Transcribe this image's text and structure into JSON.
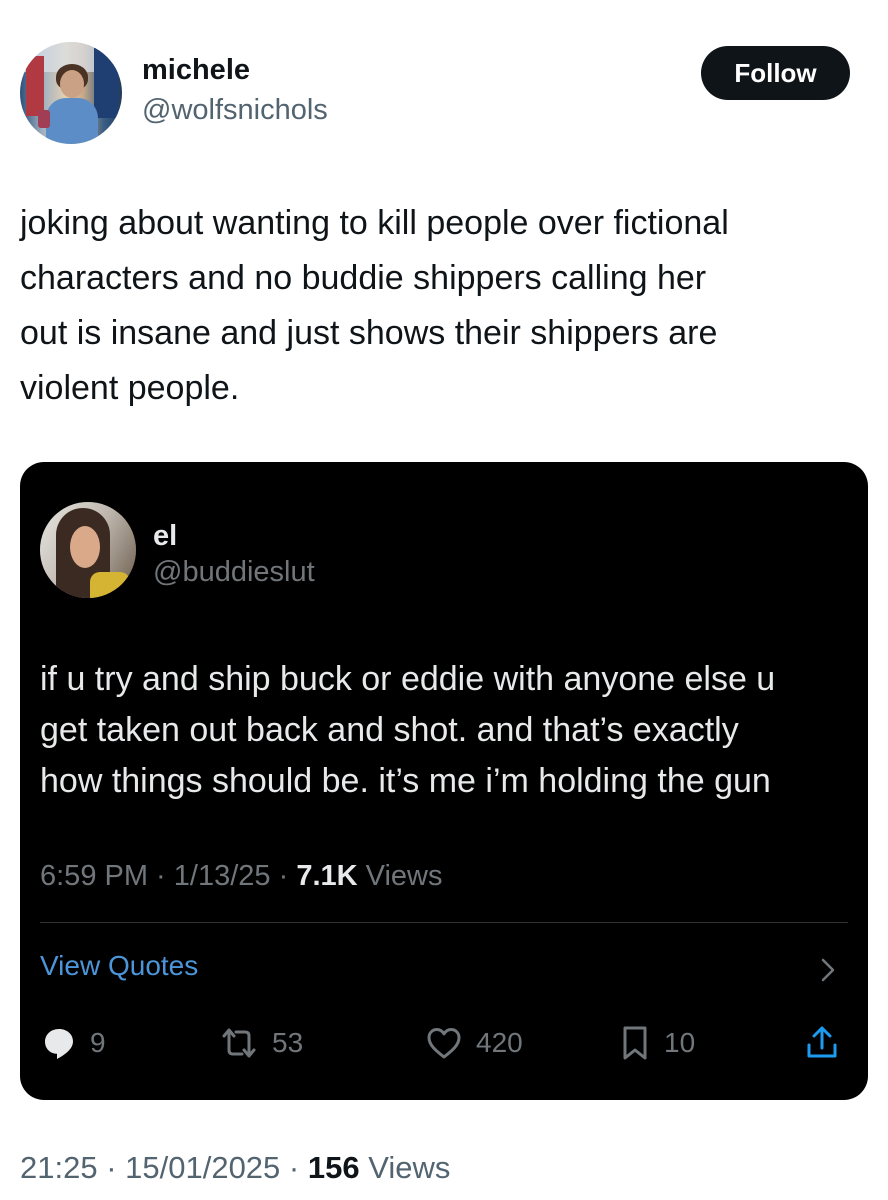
{
  "tweet": {
    "author": {
      "name": "michele",
      "handle": "@wolfsnichols",
      "avatar_icon": "profile-photo"
    },
    "follow_label": "Follow",
    "text": "joking about wanting to kill people over fictional\ncharacters and no buddie shippers calling her\nout is insane and just shows their shippers are\nviolent people.",
    "footer": {
      "time": "21:25",
      "date": "15/01/2025",
      "views_count": "156",
      "views_label": "Views"
    }
  },
  "quoted_tweet": {
    "author": {
      "name": "el",
      "handle": "@buddieslut",
      "avatar_icon": "profile-photo"
    },
    "text": "if u try and ship buck or eddie with anyone else u\nget taken out back and shot. and that’s exactly\nhow things should be. it’s me i’m holding the gun",
    "meta": {
      "time": "6:59 PM",
      "date": "1/13/25",
      "views_count": "7.1K",
      "views_label": "Views"
    },
    "view_quotes_label": "View Quotes",
    "actions": {
      "replies": "9",
      "reposts": "53",
      "likes": "420",
      "bookmarks": "10"
    }
  },
  "colors": {
    "follow_button_bg": "#0f1419",
    "quote_card_bg": "#000000",
    "link_blue": "#4b95d8",
    "muted_text": "#71767b"
  },
  "icons": [
    "reply-icon",
    "retweet-icon",
    "heart-icon",
    "bookmark-icon",
    "share-icon",
    "chevron-right-icon"
  ]
}
